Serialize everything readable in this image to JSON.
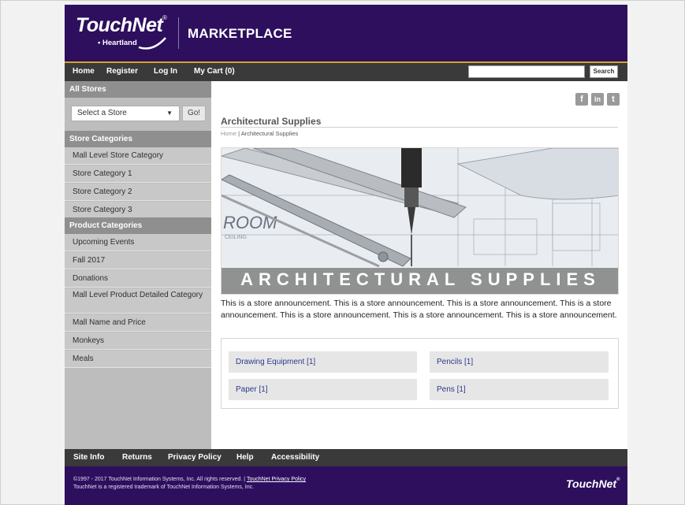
{
  "header": {
    "logo_text": "TouchNet",
    "logo_reg": "®",
    "logo_sub": "• Heartland",
    "title": "MARKETPLACE"
  },
  "nav": {
    "items": [
      "Home",
      "Register",
      "Log In",
      "My Cart (0)"
    ],
    "search_placeholder": "",
    "search_label": "Search"
  },
  "sidebar": {
    "all_stores": "All Stores",
    "select_value": "Select a Store",
    "go_label": "Go!",
    "store_categories_heading": "Store Categories",
    "store_categories": [
      "Mall Level Store Category",
      "Store Category 1",
      "Store Category 2",
      "Store Category 3"
    ],
    "product_categories_heading": "Product Categories",
    "product_categories": [
      "Upcoming Events",
      "Fall 2017",
      "Donations",
      "Mall Level Product Detailed Category",
      "Mall Name and Price",
      "Monkeys",
      "Meals"
    ]
  },
  "main": {
    "social": [
      "f",
      "in",
      "t"
    ],
    "title": "Architectural Supplies",
    "breadcrumb_home": "Home",
    "breadcrumb_sep": " | ",
    "breadcrumb_current": "Architectural Supplies",
    "banner_text": "ARCHITECTURAL SUPPLIES",
    "announcement": "This is a store announcement. This is a store announcement. This is a store announcement. This is a store announcement. This is a store announcement. This is a store announcement. This is a store announcement.",
    "categories": [
      "Drawing Equipment [1]",
      "Pencils [1]",
      "Paper [1]",
      "Pens [1]"
    ]
  },
  "footer": {
    "links": [
      "Site Info",
      "Returns",
      "Privacy Policy",
      "Help",
      "Accessibility"
    ],
    "copyright": "©1997 - 2017 TouchNet Information Systems, Inc. All rights reserved. | ",
    "privacy_link": "TouchNet Privacy Policy",
    "trademark": "TouchNet is a registered trademark of TouchNet Information Systems, Inc.",
    "logo_text": "TouchNet",
    "logo_reg": "®"
  },
  "colors": {
    "header_purple": "#2d0f5e",
    "nav_dark": "#3a3a3a",
    "gold_accent": "#d8a329",
    "sidebar_gray": "#bdbdbd",
    "link_blue": "#2c3a8c"
  }
}
